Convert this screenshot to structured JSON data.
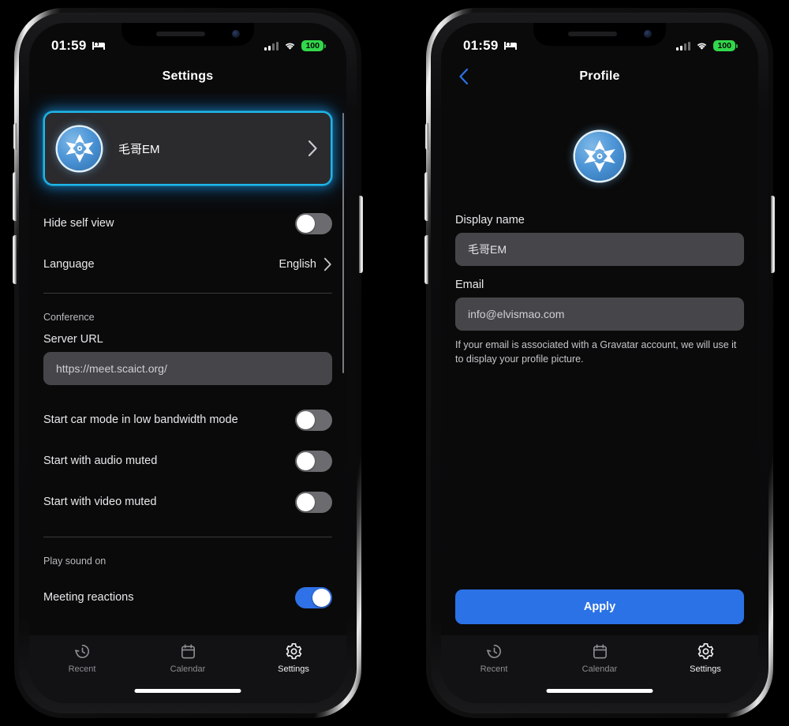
{
  "status_bar": {
    "time": "01:59",
    "bed_icon": "bed-icon",
    "signal_icon": "signal-bars-icon",
    "wifi_icon": "wifi-icon",
    "battery_level": "100"
  },
  "colors": {
    "accent_blue": "#2b72e6",
    "toggle_on": "#2f71e6",
    "toggle_off": "#6c6c70",
    "glow_cyan": "#1fb6e8",
    "battery_green": "#32d74b",
    "screen_bg": "#0a0a0a",
    "field_bg": "#46464a",
    "card_bg": "#2b2b2e"
  },
  "settings_screen": {
    "title": "Settings",
    "profile_card": {
      "name": "毛哥EM",
      "avatar_icon": "user-avatar-star-logo",
      "chevron_icon": "chevron-right-icon"
    },
    "rows": [
      {
        "label": "Hide self view",
        "type": "toggle",
        "state": "off"
      },
      {
        "label": "Language",
        "type": "link",
        "value": "English"
      }
    ],
    "conference": {
      "section_title": "Conference",
      "server_url_label": "Server URL",
      "server_url_value": "https://meet.scaict.org/",
      "toggles": [
        {
          "label": "Start car mode in low bandwidth mode",
          "state": "off"
        },
        {
          "label": "Start with audio muted",
          "state": "off"
        },
        {
          "label": "Start with video muted",
          "state": "off"
        }
      ]
    },
    "play_sound_on": {
      "section_title": "Play sound on",
      "toggles": [
        {
          "label": "Meeting reactions",
          "state": "on"
        }
      ]
    }
  },
  "profile_screen": {
    "title": "Profile",
    "back_icon": "chevron-left-icon",
    "avatar_icon": "user-avatar-star-logo",
    "display_name_label": "Display name",
    "display_name_value": "毛哥EM",
    "email_label": "Email",
    "email_value": "info@elvismao.com",
    "gravatar_helper": "If your email is associated with a Gravatar account, we will use it to display your profile picture.",
    "apply_label": "Apply"
  },
  "tab_bar": {
    "tabs": [
      {
        "label": "Recent",
        "icon": "history-clock-icon",
        "active": false
      },
      {
        "label": "Calendar",
        "icon": "calendar-icon",
        "active": false
      },
      {
        "label": "Settings",
        "icon": "gear-icon",
        "active": true
      }
    ]
  }
}
